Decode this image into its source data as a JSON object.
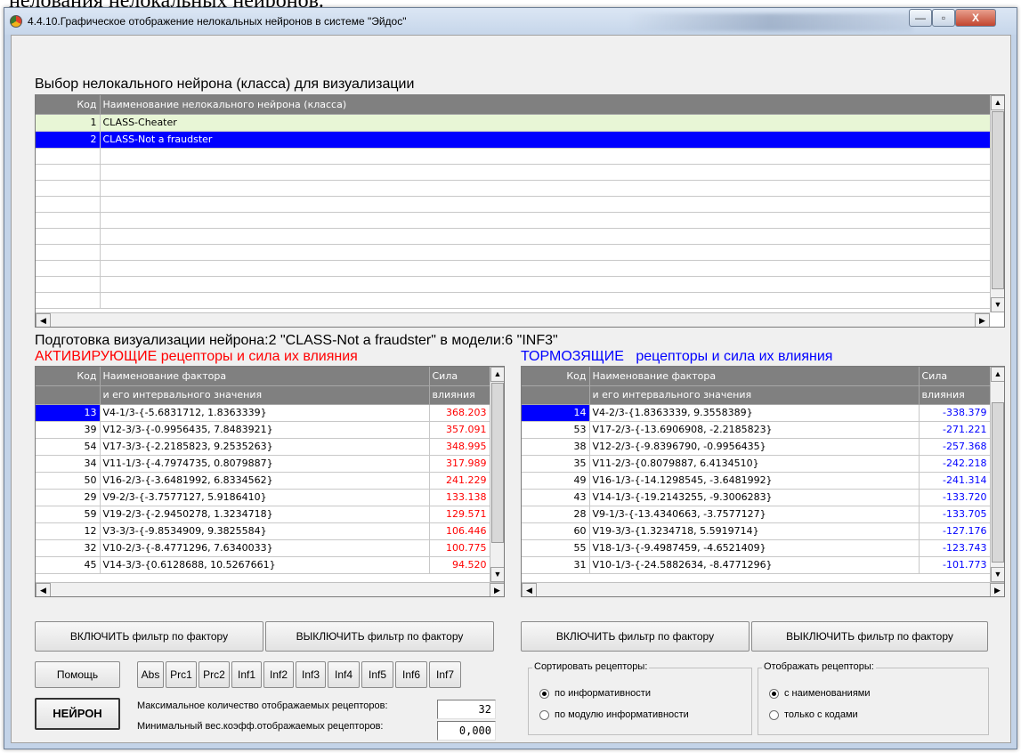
{
  "doc_text": "нелования нелокальных нейронов.",
  "window": {
    "title": "4.4.10.Графическое отображение нелокальных нейронов в системе \"Эйдос\"",
    "min_label": "—",
    "max_label": "▫",
    "close_label": "X"
  },
  "class_select": {
    "heading": "Выбор нелокального нейрона (класса) для визуализации",
    "col_code": "Код",
    "col_name": "Наименование нелокального нейрона (класса)",
    "rows": [
      {
        "code": "1",
        "name": "CLASS-Cheater"
      },
      {
        "code": "2",
        "name": "CLASS-Not a fraudster"
      },
      {
        "code": "",
        "name": ""
      },
      {
        "code": "",
        "name": ""
      },
      {
        "code": "",
        "name": ""
      },
      {
        "code": "",
        "name": ""
      },
      {
        "code": "",
        "name": ""
      },
      {
        "code": "",
        "name": ""
      },
      {
        "code": "",
        "name": ""
      },
      {
        "code": "",
        "name": ""
      },
      {
        "code": "",
        "name": ""
      },
      {
        "code": "",
        "name": ""
      }
    ]
  },
  "prep_heading": "Подготовка визуализации нейрона:2 \"CLASS-Not a fraudster\" в модели:6 \"INF3\"",
  "activating": {
    "heading": "АКТИВИРУЮЩИЕ рецепторы и сила их влияния",
    "col_code": "Код",
    "col_name1": "Наименование фактора",
    "col_name2": "и его интервального значения",
    "col_val1": "Сила",
    "col_val2": "влияния",
    "rows": [
      {
        "code": "13",
        "name": "V4-1/3-{-5.6831712, 1.8363339}",
        "value": "368.203"
      },
      {
        "code": "39",
        "name": "V12-3/3-{-0.9956435, 7.8483921}",
        "value": "357.091"
      },
      {
        "code": "54",
        "name": "V17-3/3-{-2.2185823, 9.2535263}",
        "value": "348.995"
      },
      {
        "code": "34",
        "name": "V11-1/3-{-4.7974735, 0.8079887}",
        "value": "317.989"
      },
      {
        "code": "50",
        "name": "V16-2/3-{-3.6481992, 6.8334562}",
        "value": "241.229"
      },
      {
        "code": "29",
        "name": "V9-2/3-{-3.7577127, 5.9186410}",
        "value": "133.138"
      },
      {
        "code": "59",
        "name": "V19-2/3-{-2.9450278, 1.3234718}",
        "value": "129.571"
      },
      {
        "code": "12",
        "name": "V3-3/3-{-9.8534909, 9.3825584}",
        "value": "106.446"
      },
      {
        "code": "32",
        "name": "V10-2/3-{-8.4771296, 7.6340033}",
        "value": "100.775"
      },
      {
        "code": "45",
        "name": "V14-3/3-{0.6128688, 10.5267661}",
        "value": "94.520"
      }
    ],
    "btn_on": "ВКЛЮЧИТЬ фильтр по фактору",
    "btn_off": "ВЫКЛЮЧИТЬ фильтр по фактору"
  },
  "inhibiting": {
    "heading_a": "ТОРМОЗЯЩИЕ",
    "heading_b": "рецепторы и сила их влияния",
    "col_code": "Код",
    "col_name1": "Наименование фактора",
    "col_name2": "и его интервального значения",
    "col_val1": "Сила",
    "col_val2": "влияния",
    "rows": [
      {
        "code": "14",
        "name": "V4-2/3-{1.8363339, 9.3558389}",
        "value": "-338.379"
      },
      {
        "code": "53",
        "name": "V17-2/3-{-13.6906908, -2.2185823}",
        "value": "-271.221"
      },
      {
        "code": "38",
        "name": "V12-2/3-{-9.8396790, -0.9956435}",
        "value": "-257.368"
      },
      {
        "code": "35",
        "name": "V11-2/3-{0.8079887, 6.4134510}",
        "value": "-242.218"
      },
      {
        "code": "49",
        "name": "V16-1/3-{-14.1298545, -3.6481992}",
        "value": "-241.314"
      },
      {
        "code": "43",
        "name": "V14-1/3-{-19.2143255, -9.3006283}",
        "value": "-133.720"
      },
      {
        "code": "28",
        "name": "V9-1/3-{-13.4340663, -3.7577127}",
        "value": "-133.705"
      },
      {
        "code": "60",
        "name": "V19-3/3-{1.3234718, 5.5919714}",
        "value": "-127.176"
      },
      {
        "code": "55",
        "name": "V18-1/3-{-9.4987459, -4.6521409}",
        "value": "-123.743"
      },
      {
        "code": "31",
        "name": "V10-1/3-{-24.5882634, -8.4771296}",
        "value": "-101.773"
      }
    ],
    "btn_on": "ВКЛЮЧИТЬ фильтр по фактору",
    "btn_off": "ВЫКЛЮЧИТЬ фильтр по фактору"
  },
  "bottom": {
    "help": "Помощь",
    "neuron": "НЕЙРОН",
    "models": [
      "Abs",
      "Prc1",
      "Prc2",
      "Inf1",
      "Inf2",
      "Inf3",
      "Inf4",
      "Inf5",
      "Inf6",
      "Inf7"
    ],
    "max_label": "Максимальное количество отображаемых рецепторов:",
    "max_value": "32",
    "min_label": "Минимальный вес.коэфф.отображаемых рецепторов:",
    "min_value": "0,000"
  },
  "sort_group": {
    "legend": "Сортировать рецепторы:",
    "opt1": "по информативности",
    "opt2": "по модулю информативности"
  },
  "display_group": {
    "legend": "Отображать рецепторы:",
    "opt1": "с наименованиями",
    "opt2": "только с кодами"
  },
  "colors": {
    "selection": "#0000ff",
    "activating": "#ff0000",
    "inhibiting": "#0000ff",
    "header": "#808080",
    "row_highlight": "#e8f6d6"
  }
}
